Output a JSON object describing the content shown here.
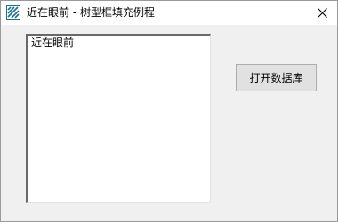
{
  "window": {
    "title": "近在眼前 - 树型框填充例程",
    "icon": "app-logo-icon",
    "close_icon": "close-icon"
  },
  "tree": {
    "items": [
      {
        "label": "近在眼前"
      }
    ]
  },
  "buttons": {
    "open_database": "打开数据库"
  },
  "colors": {
    "window_bg": "#f0f0f0",
    "titlebar_bg": "#ffffff",
    "logo": "#1f6f98",
    "button_bg": "#e1e1e1",
    "button_border": "#adadad"
  }
}
